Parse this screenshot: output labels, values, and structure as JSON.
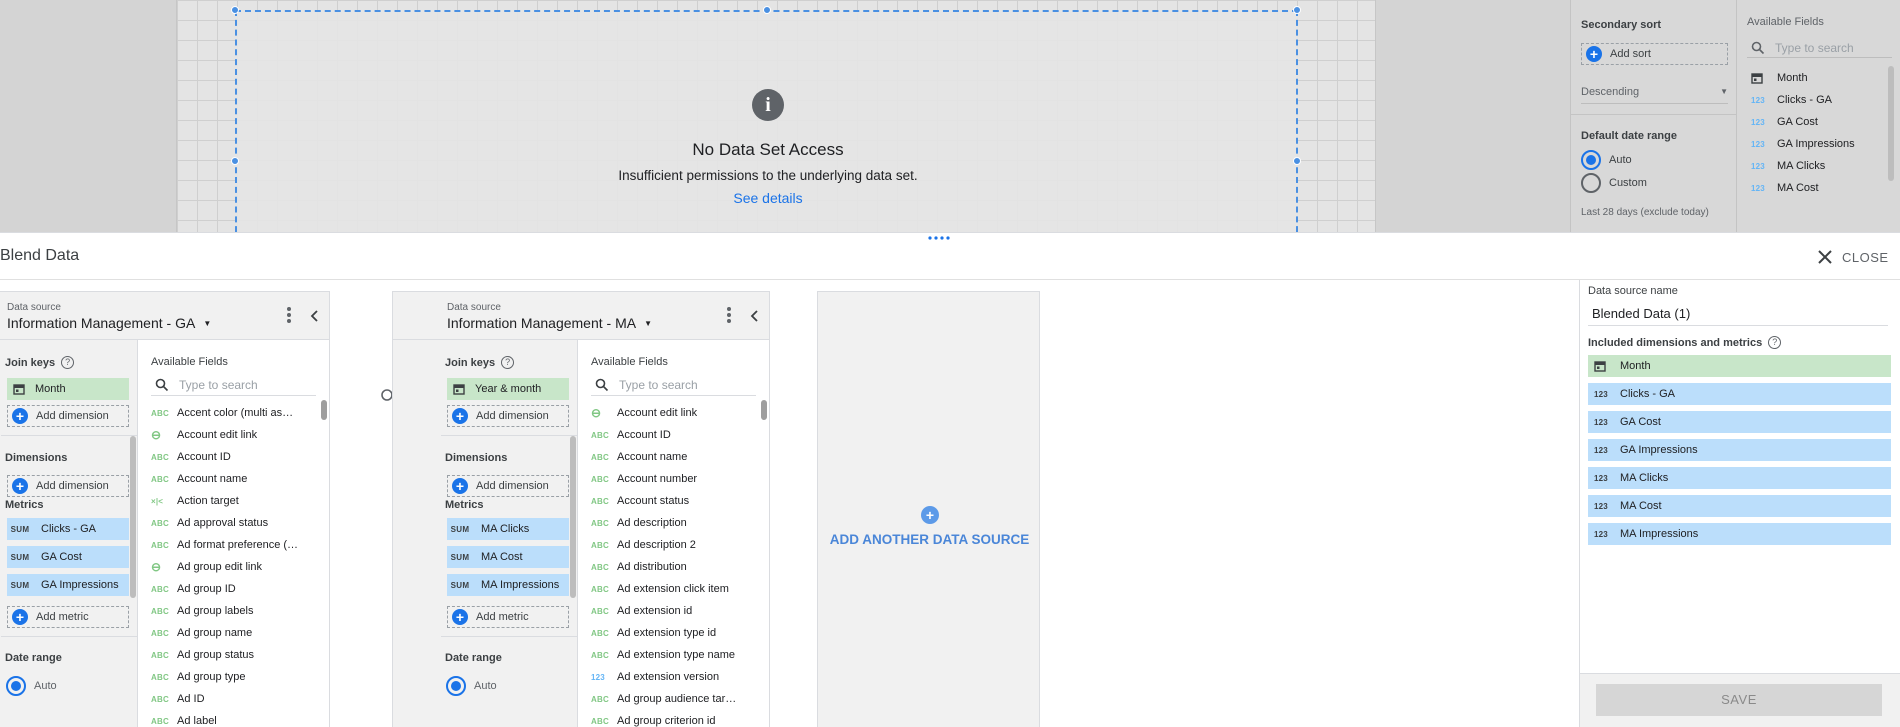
{
  "canvas": {
    "no_data_title": "No Data Set Access",
    "no_data_message": "Insufficient permissions to the underlying data set.",
    "see_details": "See details"
  },
  "props_panel": {
    "secondary_sort_label": "Secondary sort",
    "add_sort": "Add sort",
    "sort_order": "Descending",
    "default_date_range_label": "Default date range",
    "auto_label": "Auto",
    "custom_label": "Custom",
    "date_range_note": "Last 28 days (exclude today)",
    "available_fields_label": "Available Fields",
    "search_placeholder": "Type to search",
    "fields": [
      {
        "type": "date",
        "name": "Month"
      },
      {
        "type": "123",
        "name": "Clicks - GA"
      },
      {
        "type": "123",
        "name": "GA Cost"
      },
      {
        "type": "123",
        "name": "GA Impressions"
      },
      {
        "type": "123",
        "name": "MA Clicks"
      },
      {
        "type": "123",
        "name": "MA Cost"
      }
    ]
  },
  "blend": {
    "title": "Blend Data",
    "close": "CLOSE",
    "add_another": "ADD ANOTHER DATA SOURCE",
    "sources": [
      {
        "label": "Data source",
        "name": "Information Management - GA",
        "join_keys_label": "Join keys",
        "join_key": "Month",
        "add_dimension": "Add dimension",
        "dimensions_label": "Dimensions",
        "metrics_label": "Metrics",
        "metrics": [
          "Clicks - GA",
          "GA Cost",
          "GA Impressions"
        ],
        "metric_agg": "SUM",
        "add_metric": "Add metric",
        "date_range_label": "Date range",
        "date_range_value": "Auto",
        "available_fields_label": "Available Fields",
        "search_placeholder": "Type to search",
        "fields": [
          {
            "type": "ABC",
            "name": "Accent color (multi as…"
          },
          {
            "type": "link",
            "name": "Account edit link"
          },
          {
            "type": "ABC",
            "name": "Account ID"
          },
          {
            "type": "ABC",
            "name": "Account name"
          },
          {
            "type": "xy",
            "name": "Action target"
          },
          {
            "type": "ABC",
            "name": "Ad approval status"
          },
          {
            "type": "ABC",
            "name": "Ad format preference (…"
          },
          {
            "type": "link",
            "name": "Ad group edit link"
          },
          {
            "type": "ABC",
            "name": "Ad group ID"
          },
          {
            "type": "ABC",
            "name": "Ad group labels"
          },
          {
            "type": "ABC",
            "name": "Ad group name"
          },
          {
            "type": "ABC",
            "name": "Ad group status"
          },
          {
            "type": "ABC",
            "name": "Ad group type"
          },
          {
            "type": "ABC",
            "name": "Ad ID"
          },
          {
            "type": "ABC",
            "name": "Ad label"
          }
        ]
      },
      {
        "label": "Data source",
        "name": "Information Management - MA",
        "join_keys_label": "Join keys",
        "join_key": "Year & month",
        "add_dimension": "Add dimension",
        "dimensions_label": "Dimensions",
        "metrics_label": "Metrics",
        "metrics": [
          "MA Clicks",
          "MA Cost",
          "MA Impressions"
        ],
        "metric_agg": "SUM",
        "add_metric": "Add metric",
        "date_range_label": "Date range",
        "date_range_value": "Auto",
        "available_fields_label": "Available Fields",
        "search_placeholder": "Type to search",
        "fields": [
          {
            "type": "link",
            "name": "Account edit link"
          },
          {
            "type": "ABC",
            "name": "Account ID"
          },
          {
            "type": "ABC",
            "name": "Account name"
          },
          {
            "type": "ABC",
            "name": "Account number"
          },
          {
            "type": "ABC",
            "name": "Account status"
          },
          {
            "type": "ABC",
            "name": "Ad description"
          },
          {
            "type": "ABC",
            "name": "Ad description 2"
          },
          {
            "type": "ABC",
            "name": "Ad distribution"
          },
          {
            "type": "ABC",
            "name": "Ad extension click item"
          },
          {
            "type": "ABC",
            "name": "Ad extension id"
          },
          {
            "type": "ABC",
            "name": "Ad extension type id"
          },
          {
            "type": "ABC",
            "name": "Ad extension type name"
          },
          {
            "type": "123",
            "name": "Ad extension version"
          },
          {
            "type": "ABC",
            "name": "Ad group audience tar…"
          },
          {
            "type": "ABC",
            "name": "Ad group criterion id"
          }
        ]
      }
    ],
    "right": {
      "name_label": "Data source name",
      "name_value": "Blended Data (1)",
      "included_label": "Included dimensions and metrics",
      "included": [
        {
          "type": "date",
          "name": "Month"
        },
        {
          "type": "123",
          "name": "Clicks - GA"
        },
        {
          "type": "123",
          "name": "GA Cost"
        },
        {
          "type": "123",
          "name": "GA Impressions"
        },
        {
          "type": "123",
          "name": "MA Clicks"
        },
        {
          "type": "123",
          "name": "MA Cost"
        },
        {
          "type": "123",
          "name": "MA Impressions"
        }
      ],
      "save": "SAVE"
    }
  },
  "colors": {
    "accent": "#1a73e8",
    "dimension_chip": "#c8e6c9",
    "metric_chip": "#bbdefb"
  }
}
